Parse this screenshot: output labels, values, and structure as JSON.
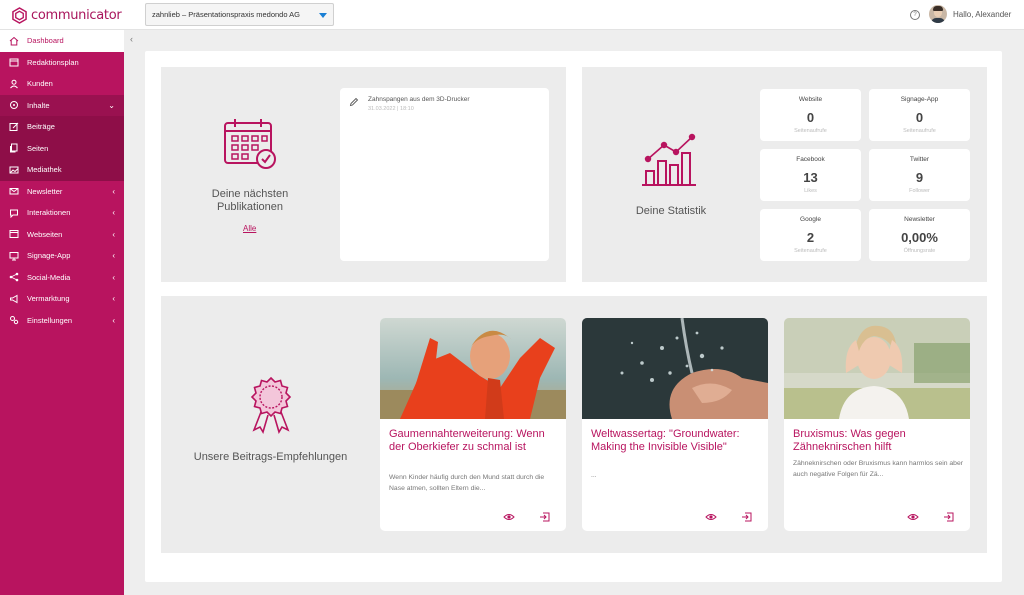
{
  "app": {
    "logo_text": "communicator",
    "brand_color": "#b8145f"
  },
  "header": {
    "practice_selector": "zahnlieb – Präsentationspraxis medondo AG",
    "help_icon": "?",
    "greeting": "Hallo, Alexander"
  },
  "sidebar": {
    "items": [
      {
        "label": "Dashboard",
        "icon": "home-icon"
      },
      {
        "label": "Redaktionsplan",
        "icon": "calendar-icon"
      },
      {
        "label": "Kunden",
        "icon": "user-icon"
      },
      {
        "label": "Inhalte",
        "icon": "content-icon",
        "arrow": "⌄"
      },
      {
        "label": "Beiträge",
        "icon": "edit-icon"
      },
      {
        "label": "Seiten",
        "icon": "pages-icon"
      },
      {
        "label": "Mediathek",
        "icon": "image-icon"
      },
      {
        "label": "Newsletter",
        "icon": "mail-icon",
        "arrow": "‹"
      },
      {
        "label": "Interaktionen",
        "icon": "chat-icon",
        "arrow": "‹"
      },
      {
        "label": "Webseiten",
        "icon": "browser-icon",
        "arrow": "‹"
      },
      {
        "label": "Signage-App",
        "icon": "monitor-icon",
        "arrow": "‹"
      },
      {
        "label": "Social-Media",
        "icon": "share-icon",
        "arrow": "‹"
      },
      {
        "label": "Vermarktung",
        "icon": "megaphone-icon",
        "arrow": "‹"
      },
      {
        "label": "Einstellungen",
        "icon": "settings-icon",
        "arrow": "‹"
      }
    ],
    "collapse_symbol": "‹"
  },
  "publications": {
    "title": "Deine nächsten Publikationen",
    "link": "Alle",
    "entry_title": "Zahnspangen aus dem 3D-Drucker",
    "entry_date": "31.03.2022 | 18:10"
  },
  "statistics": {
    "title": "Deine Statistik",
    "boxes": [
      {
        "label": "Website",
        "value": "0",
        "sub": "Seitenaufrufe"
      },
      {
        "label": "Signage-App",
        "value": "0",
        "sub": "Seitenaufrufe"
      },
      {
        "label": "Facebook",
        "value": "13",
        "sub": "Likes"
      },
      {
        "label": "Twitter",
        "value": "9",
        "sub": "Follower"
      },
      {
        "label": "Google",
        "value": "2",
        "sub": "Seitenaufrufe"
      },
      {
        "label": "Newsletter",
        "value": "0,00%",
        "sub": "Öffnungsrate"
      }
    ]
  },
  "recommendations": {
    "title": "Unsere Beitrags-Empfehlungen",
    "articles": [
      {
        "title": "Gaumennahterweiterung: Wenn der Oberkiefer zu schmal ist",
        "text": "Wenn Kinder häufig durch den Mund statt durch die Nase atmen, sollten Eltern die..."
      },
      {
        "title": "Weltwassertag: \"Groundwater: Making the Invisible Visible\"",
        "text": "..."
      },
      {
        "title": "Bruxismus: Was gegen Zähneknirschen hilft",
        "text": "Zähneknirschen oder Bruxismus kann harmlos sein aber auch negative Folgen für Zä..."
      }
    ]
  }
}
